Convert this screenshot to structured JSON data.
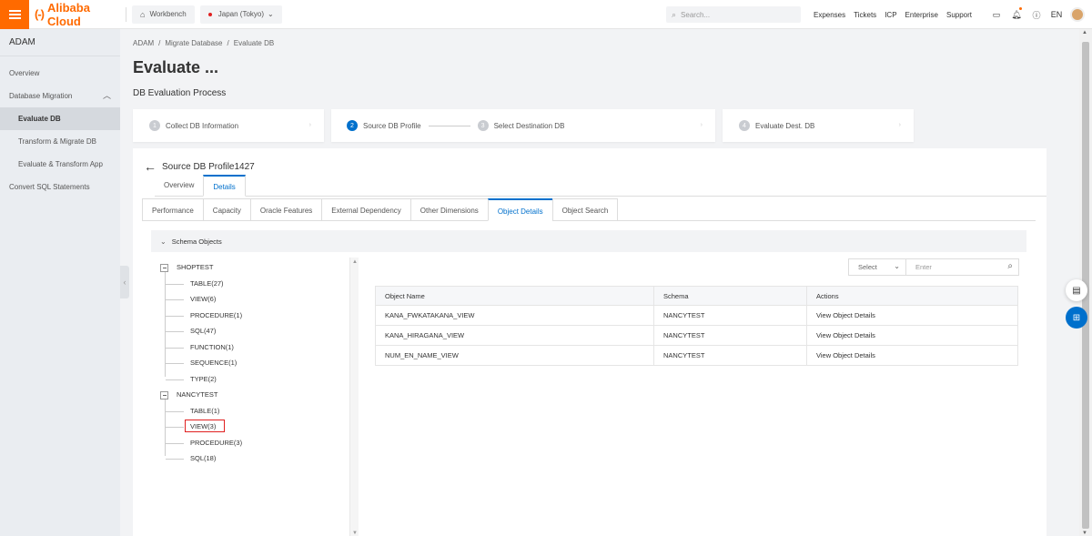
{
  "topbar": {
    "brand": "Alibaba Cloud",
    "brand_mark": "(-)",
    "workbench": "Workbench",
    "region": "Japan (Tokyo)",
    "search_placeholder": "Search...",
    "links": [
      "Expenses",
      "Tickets",
      "ICP",
      "Enterprise",
      "Support"
    ],
    "lang": "EN",
    "accent_color": "#ff6a00"
  },
  "sidebar": {
    "title": "ADAM",
    "items": [
      {
        "label": "Overview"
      },
      {
        "label": "Database Migration"
      },
      {
        "label": "Evaluate DB"
      },
      {
        "label": "Transform & Migrate DB"
      },
      {
        "label": "Evaluate & Transform App"
      },
      {
        "label": "Convert SQL Statements"
      }
    ]
  },
  "breadcrumb": [
    "ADAM",
    "Migrate Database",
    "Evaluate DB"
  ],
  "page_title": "Evaluate ...",
  "section_label": "DB Evaluation Process",
  "steps": [
    {
      "num": "1",
      "label": "Collect DB Information"
    },
    {
      "num": "2",
      "label": "Source DB Profile"
    },
    {
      "num": "3",
      "label": "Select Destination DB"
    },
    {
      "num": "4",
      "label": "Evaluate Dest. DB"
    }
  ],
  "profile": {
    "title": "Source DB Profile1427",
    "tabs": [
      "Overview",
      "Details"
    ],
    "subtabs": [
      "Performance",
      "Capacity",
      "Oracle Features",
      "External Dependency",
      "Other Dimensions",
      "Object Details",
      "Object Search"
    ]
  },
  "schema_header": "Schema Objects",
  "tree": [
    {
      "schema": "SHOPTEST",
      "children": [
        "TABLE(27)",
        "VIEW(6)",
        "PROCEDURE(1)",
        "SQL(47)",
        "FUNCTION(1)",
        "SEQUENCE(1)",
        "TYPE(2)"
      ]
    },
    {
      "schema": "NANCYTEST",
      "children": [
        "TABLE(1)",
        "VIEW(3)",
        "PROCEDURE(3)",
        "SQL(18)"
      ]
    }
  ],
  "filter": {
    "select": "Select",
    "placeholder": "Enter"
  },
  "table": {
    "headers": [
      "Object Name",
      "Schema",
      "Actions"
    ],
    "rows": [
      [
        "KANA_FWKATAKANA_VIEW",
        "NANCYTEST",
        "View Object Details"
      ],
      [
        "KANA_HIRAGANA_VIEW",
        "NANCYTEST",
        "View Object Details"
      ],
      [
        "NUM_EN_NAME_VIEW",
        "NANCYTEST",
        "View Object Details"
      ]
    ]
  },
  "colors": {
    "primary": "#0070cc",
    "highlight": "#e02020"
  }
}
